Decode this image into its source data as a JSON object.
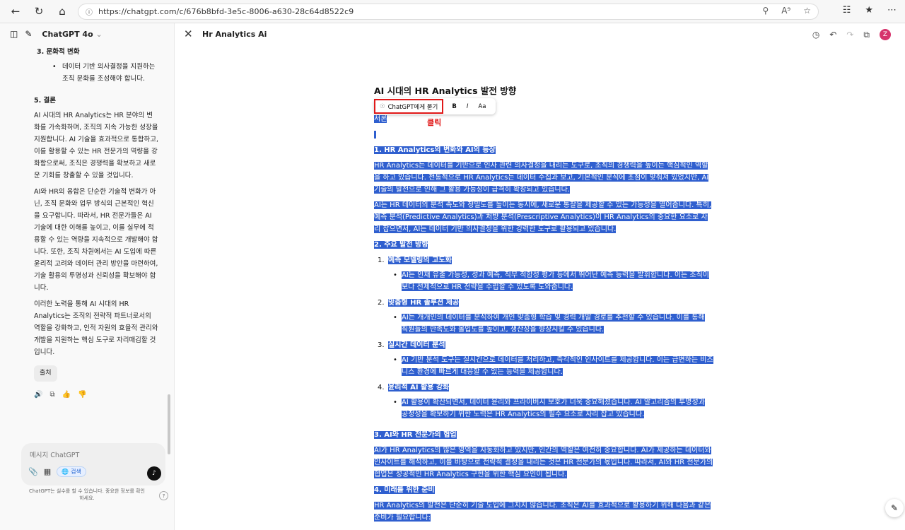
{
  "browser": {
    "url": "https://chatgpt.com/c/676b8bfd-3e5c-8006-a630-28c64d8522c9"
  },
  "sidebar": {
    "model_label": "ChatGPT 4o",
    "section3_heading": "3.  문화적 변화",
    "section3_bullet": "데이터 기반 의사결정을 지원하는 조직 문화를 조성해야 합니다.",
    "section5_heading": "5. 결론",
    "para1": "AI 시대의 HR Analytics는 HR 분야의 변화를 가속화하며, 조직의 지속 가능한 성장을 지원합니다. AI 기술을 효과적으로 통합하고, 이를 활용할 수 있는 HR 전문가의 역량을 강화함으로써, 조직은 경쟁력을 확보하고 새로운 기회를 창출할 수 있을 것입니다.",
    "para2": "AI와 HR의 융합은 단순한 기술적 변화가 아닌, 조직 문화와 업무 방식의 근본적인 혁신을 요구합니다. 따라서, HR 전문가들은 AI 기술에 대한 이해를 높이고, 이를 실무에 적용할 수 있는 역량을 지속적으로 개발해야 합니다. 또한, 조직 차원에서는 AI 도입에 따른 윤리적 고려와 데이터 관리 방안을 마련하여, 기술 활용의 투명성과 신뢰성을 확보해야 합니다.",
    "para3": "이러한 노력을 통해 AI 시대의 HR Analytics는 조직의 전략적 파트너로서의 역할을 강화하고, 인적 자원의 효율적 관리와 개발을 지원하는 핵심 도구로 자리매김할 것입니다.",
    "source_chip": "출처",
    "composer_placeholder": "메시지 ChatGPT",
    "search_label": "검색",
    "disclaimer": "ChatGPT는 실수를 할 수 있습니다. 중요한 정보를 확인하세요."
  },
  "canvas": {
    "title": "Hr Analytics Ai",
    "avatar_letter": "Z"
  },
  "toolbar": {
    "ask_label": "ChatGPT에게 묻기",
    "bold": "B",
    "italic": "I",
    "size": "Aa"
  },
  "annotation": "클릭",
  "doc": {
    "title": "AI 시대의 HR Analytics 발전 방향",
    "intro": "서론",
    "s1_heading": "1. HR Analytics의 변화와 AI의 등장",
    "s1_p1": "HR Analytics는 데이터를 기반으로 인사 관련 의사결정을 내리는 도구로, 조직의 경쟁력을 높이는 핵심적인 역할을 하고 있습니다. 전통적으로 HR Analytics는 데이터 수집과 보고, 기본적인 분석에 초점이 맞춰져 있었지만, AI 기술의 발전으로 인해 그 활용 가능성이 급격히 확장되고 있습니다.",
    "s1_p2": "AI는 HR 데이터의 분석 속도와 정밀도를 높이는 동시에, 새로운 통찰을 제공할 수 있는 가능성을 열어줍니다. 특히, 예측 분석(Predictive Analytics)과 처방 분석(Prescriptive Analytics)이 HR Analytics의 중요한 요소로 자리 잡으면서, AI는 데이터 기반 의사결정을 위한 강력한 도구로 활용되고 있습니다.",
    "s2_heading": "2. 주요 발전 방향",
    "items": [
      {
        "num": "1.",
        "title": "예측 모델링의 고도화",
        "text": "AI는 인재 유출 가능성, 성과 예측, 직무 적합성 평가 등에서 뛰어난 예측 능력을 발휘합니다. 이는 조직이 보다 선제적으로 HR 전략을 수립할 수 있도록 도와줍니다."
      },
      {
        "num": "2.",
        "title": "맞춤형 HR 솔루션 제공",
        "text": "AI는 개개인의 데이터를 분석하여 개인 맞춤형 학습 및 경력 개발 경로를 추천할 수 있습니다. 이를 통해 직원들의 만족도와 몰입도를 높이고, 생산성을 향상시킬 수 있습니다."
      },
      {
        "num": "3.",
        "title": "실시간 데이터 분석",
        "text": "AI 기반 분석 도구는 실시간으로 데이터를 처리하고, 즉각적인 인사이트를 제공합니다. 이는 급변하는 비즈니스 환경에 빠르게 대응할 수 있는 능력을 제공합니다."
      },
      {
        "num": "4.",
        "title": "윤리적 AI 활용 강화",
        "text": "AI 활용이 확산되면서, 데이터 윤리와 프라이버시 보호가 더욱 중요해졌습니다. AI 알고리즘의 투명성과 공정성을 확보하기 위한 노력은 HR Analytics의 필수 요소로 자리 잡고 있습니다."
      }
    ],
    "s3_heading": "3. AI와 HR 전문가의 협업",
    "s3_p": "AI가 HR Analytics의 많은 영역을 자동화하고 있지만, 인간의 역할은 여전히 중요합니다. AI가 제공하는 데이터와 인사이트를 해석하고, 이를 바탕으로 전략적 결정을 내리는 것은 HR 전문가의 몫입니다. 따라서, AI와 HR 전문가의 협업은 성공적인 HR Analytics 구현을 위한 핵심 요인이 됩니다.",
    "s4_heading": "4. 미래를 위한 준비",
    "s4_p": "HR Analytics의 발전은 단순히 기술 도입에 그치지 않습니다. 조직은 AI를 효과적으로 활용하기 위해 다음과 같은 준비가 필요합니다:"
  }
}
